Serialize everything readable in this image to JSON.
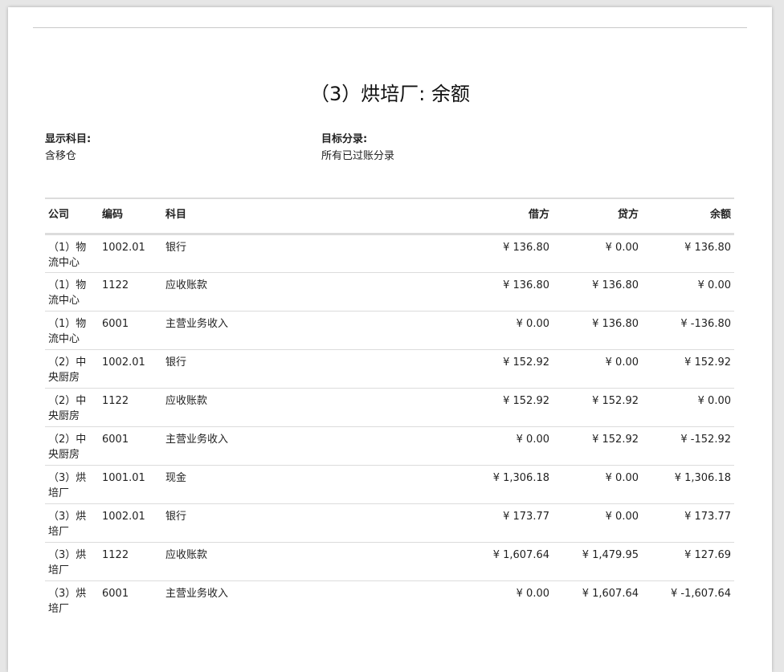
{
  "report": {
    "title": "（3）烘培厂: 余额",
    "filters": {
      "accounts_label": "显示科目:",
      "accounts_value": "含移仓",
      "entries_label": "目标分录:",
      "entries_value": "所有已过账分录"
    }
  },
  "table": {
    "headers": {
      "company": "公司",
      "code": "编码",
      "account": "科目",
      "debit": "借方",
      "credit": "贷方",
      "balance": "余额"
    },
    "rows": [
      {
        "company": "（1）物流中心",
        "code": "1002.01",
        "account": "银行",
        "debit": "¥ 136.80",
        "credit": "¥ 0.00",
        "balance": "¥ 136.80"
      },
      {
        "company": "（1）物流中心",
        "code": "1122",
        "account": "应收账款",
        "debit": "¥ 136.80",
        "credit": "¥ 136.80",
        "balance": "¥ 0.00"
      },
      {
        "company": "（1）物流中心",
        "code": "6001",
        "account": "主营业务收入",
        "debit": "¥ 0.00",
        "credit": "¥ 136.80",
        "balance": "¥ -136.80"
      },
      {
        "company": "（2）中央厨房",
        "code": "1002.01",
        "account": "银行",
        "debit": "¥ 152.92",
        "credit": "¥ 0.00",
        "balance": "¥ 152.92"
      },
      {
        "company": "（2）中央厨房",
        "code": "1122",
        "account": "应收账款",
        "debit": "¥ 152.92",
        "credit": "¥ 152.92",
        "balance": "¥ 0.00"
      },
      {
        "company": "（2）中央厨房",
        "code": "6001",
        "account": "主营业务收入",
        "debit": "¥ 0.00",
        "credit": "¥ 152.92",
        "balance": "¥ -152.92"
      },
      {
        "company": "（3）烘培厂",
        "code": "1001.01",
        "account": "现金",
        "debit": "¥ 1,306.18",
        "credit": "¥ 0.00",
        "balance": "¥ 1,306.18"
      },
      {
        "company": "（3）烘培厂",
        "code": "1002.01",
        "account": "银行",
        "debit": "¥ 173.77",
        "credit": "¥ 0.00",
        "balance": "¥ 173.77"
      },
      {
        "company": "（3）烘培厂",
        "code": "1122",
        "account": "应收账款",
        "debit": "¥ 1,607.64",
        "credit": "¥ 1,479.95",
        "balance": "¥ 127.69"
      },
      {
        "company": "（3）烘培厂",
        "code": "6001",
        "account": "主营业务收入",
        "debit": "¥ 0.00",
        "credit": "¥ 1,607.64",
        "balance": "¥ -1,607.64"
      }
    ]
  }
}
